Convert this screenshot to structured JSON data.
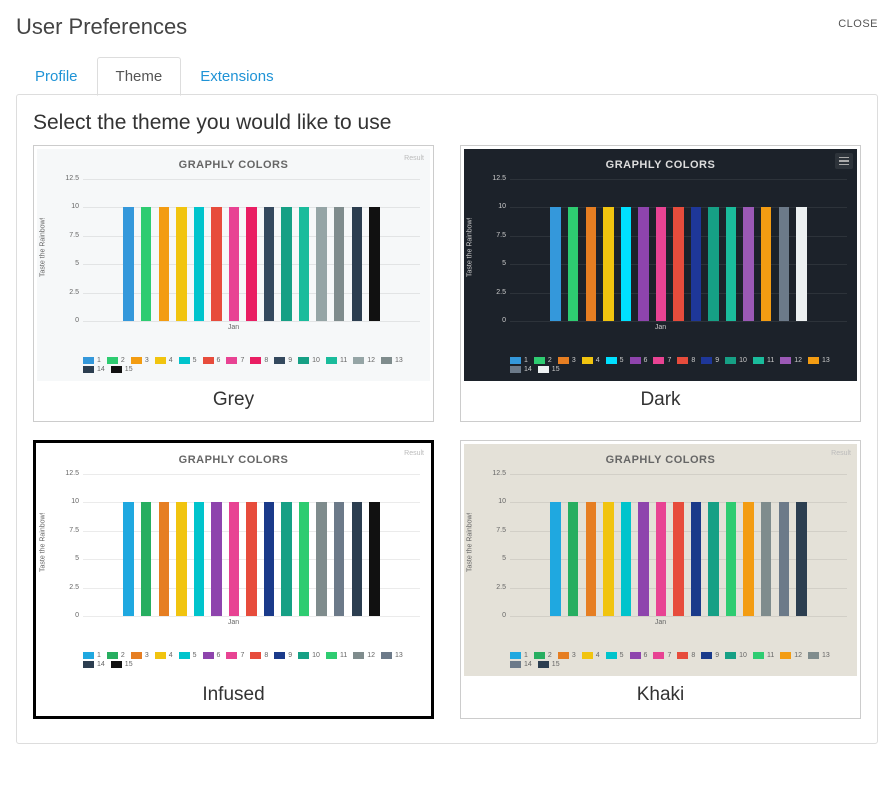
{
  "modal": {
    "title": "User Preferences",
    "close": "CLOSE"
  },
  "tabs": [
    {
      "id": "profile",
      "label": "Profile",
      "active": false
    },
    {
      "id": "theme",
      "label": "Theme",
      "active": true
    },
    {
      "id": "extensions",
      "label": "Extensions",
      "active": false
    }
  ],
  "panel": {
    "title": "Select the theme you would like to use"
  },
  "themes": [
    {
      "id": "grey",
      "label": "Grey",
      "bg": "#f6f8f9",
      "text": "#666",
      "selected": false,
      "badge": "Result"
    },
    {
      "id": "dark",
      "label": "Dark",
      "bg": "#1c222a",
      "text": "#cccccc",
      "selected": false,
      "badge": "",
      "hamburger": true
    },
    {
      "id": "infused",
      "label": "Infused",
      "bg": "#ffffff",
      "text": "#666",
      "selected": true,
      "badge": "Result"
    },
    {
      "id": "khaki",
      "label": "Khaki",
      "bg": "#e4e1d8",
      "text": "#666",
      "selected": false,
      "badge": "Result"
    }
  ],
  "chart_data": {
    "type": "bar",
    "title": "GRAPHLY COLORS",
    "xlabel": "Jan",
    "ylabel": "Taste the Rainbow!",
    "ylim": [
      0,
      12.5
    ],
    "yticks": [
      0,
      2.5,
      5,
      7.5,
      10,
      12.5
    ],
    "categories": [
      "1",
      "2",
      "3",
      "4",
      "5",
      "6",
      "7",
      "8",
      "9",
      "10",
      "11",
      "12",
      "13",
      "14",
      "15"
    ],
    "values": [
      10,
      10,
      10,
      10,
      10,
      10,
      10,
      10,
      10,
      10,
      10,
      10,
      10,
      10,
      10
    ],
    "series_colors": {
      "default": [
        "#1f77b4",
        "#2ca02c",
        "#ff7f0e",
        "#ffdd33",
        "#17becf",
        "#d62728",
        "#e377c2",
        "#9467bd",
        "#1a3a8a",
        "#8c564b",
        "#7f7f7f",
        "#3ac0b6",
        "#e6550d",
        "#636363",
        "#111111"
      ],
      "grey": [
        "#3498db",
        "#2ecc71",
        "#f39c12",
        "#f1c40f",
        "#00c4cc",
        "#e74c3c",
        "#e84393",
        "#e91e63",
        "#34495e",
        "#16a085",
        "#1abc9c",
        "#95a5a6",
        "#7f8c8d",
        "#2c3e50",
        "#111111"
      ],
      "dark": [
        "#3498db",
        "#2ecc71",
        "#e67e22",
        "#f1c40f",
        "#00e0ff",
        "#8e44ad",
        "#e84393",
        "#e74c3c",
        "#1e3799",
        "#16a085",
        "#1abc9c",
        "#9b59b6",
        "#f39c12",
        "#6c7a89",
        "#ecf0f1"
      ],
      "infused": [
        "#1fa8e0",
        "#27ae60",
        "#e67e22",
        "#f1c40f",
        "#00c4cc",
        "#8e44ad",
        "#e84393",
        "#e74c3c",
        "#1a3a8a",
        "#16a085",
        "#2ecc71",
        "#7f8c8d",
        "#6c7a89",
        "#2c3e50",
        "#111111"
      ],
      "khaki": [
        "#1fa8e0",
        "#27ae60",
        "#e67e22",
        "#f1c40f",
        "#00c4cc",
        "#8e44ad",
        "#e84393",
        "#e74c3c",
        "#1a3a8a",
        "#16a085",
        "#2ecc71",
        "#f39c12",
        "#7f8c8d",
        "#6c7a89",
        "#2c3e50"
      ]
    }
  }
}
